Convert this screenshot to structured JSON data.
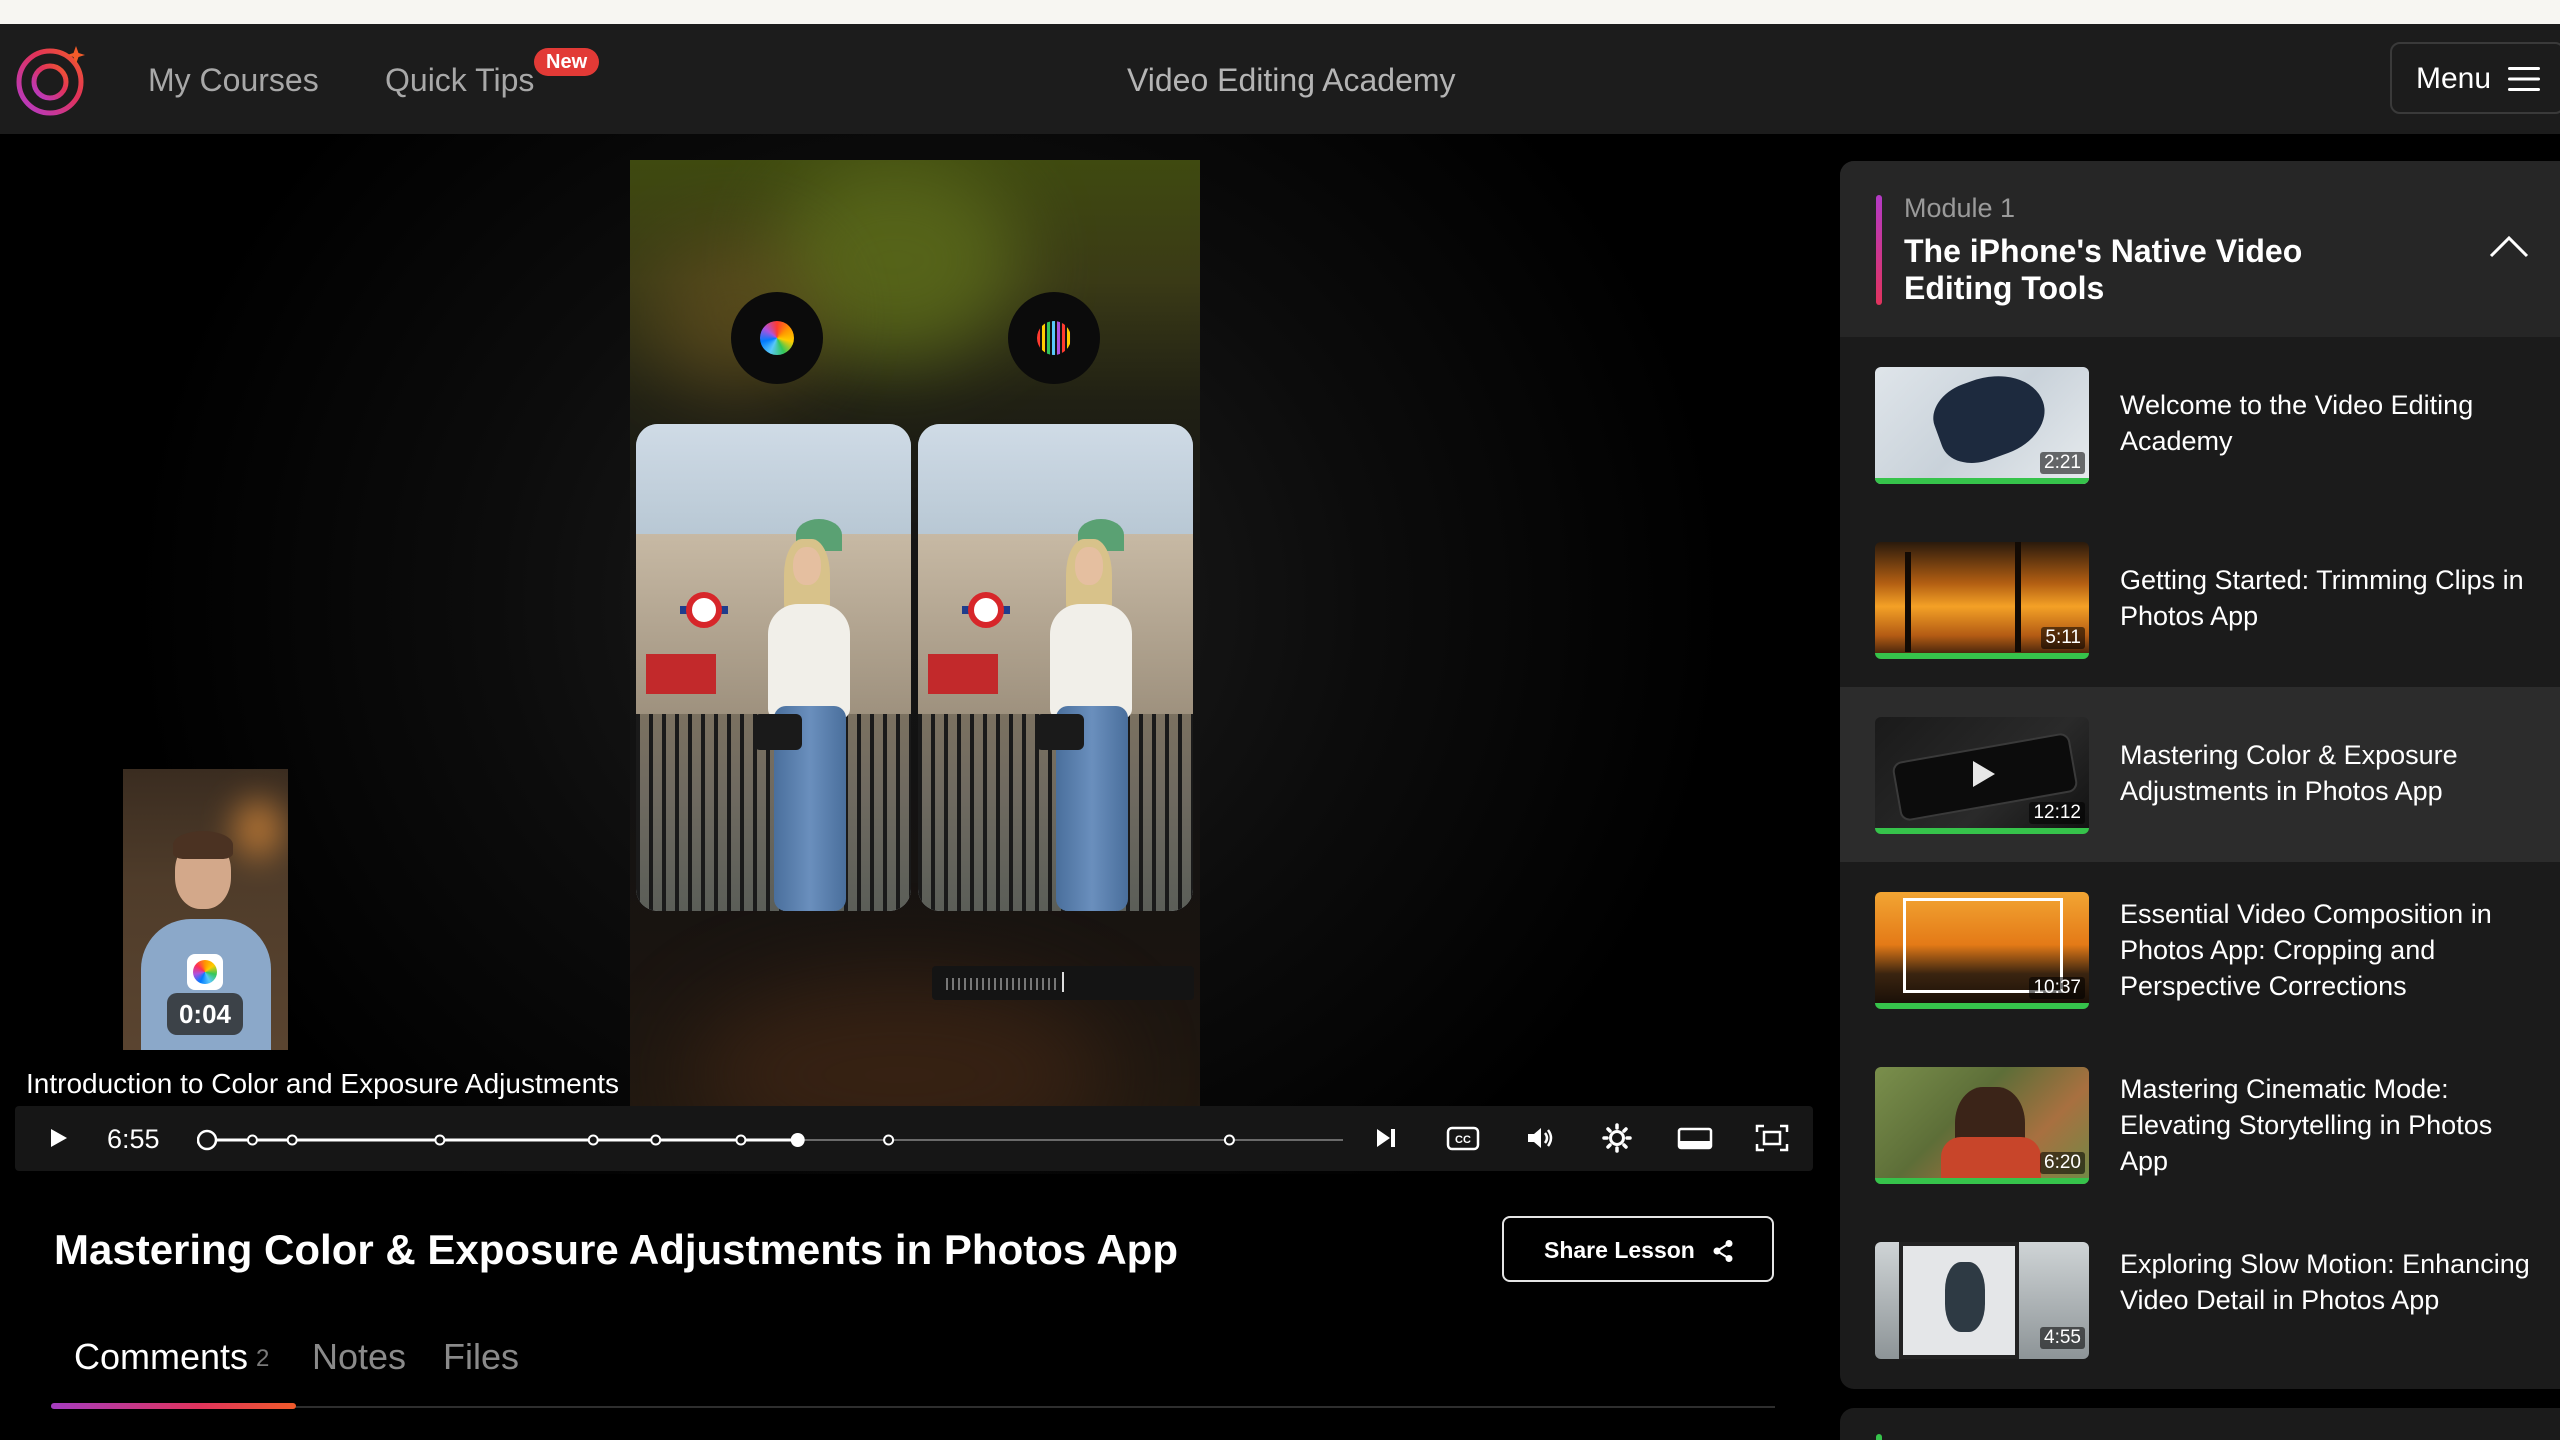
{
  "nav": {
    "my_courses": "My Courses",
    "quick_tips": "Quick Tips",
    "new_badge": "New",
    "site_title": "Video Editing Academy",
    "menu_label": "Menu"
  },
  "player": {
    "pip_time": "0:04",
    "subtitle": "Introduction to Color and Exposure Adjustments",
    "time_elapsed": "6:55",
    "progress_fraction": 0.52,
    "chapter_markers": [
      0.04,
      0.075,
      0.205,
      0.34,
      0.395,
      0.47,
      0.6,
      0.9
    ]
  },
  "lesson": {
    "title": "Mastering Color & Exposure Adjustments in Photos App",
    "share_label": "Share Lesson"
  },
  "tabs": {
    "comments": "Comments",
    "comments_count": "2",
    "notes": "Notes",
    "files": "Files"
  },
  "sidebar": {
    "module_label": "Module 1",
    "module_title": "The iPhone's Native Video Editing Tools",
    "lessons": [
      {
        "title": "Welcome to the Video Editing Academy",
        "duration": "2:21"
      },
      {
        "title": "Getting Started: Trimming Clips in Photos App",
        "duration": "5:11"
      },
      {
        "title": "Mastering Color & Exposure Adjustments in Photos App",
        "duration": "12:12",
        "active": true
      },
      {
        "title": "Essential Video Composition in Photos App: Cropping and Perspective Corrections",
        "duration": "10:37"
      },
      {
        "title": "Mastering Cinematic Mode: Elevating Storytelling in Photos App",
        "duration": "6:20"
      },
      {
        "title": "Exploring Slow Motion: Enhancing Video Detail in Photos App",
        "duration": "4:55"
      }
    ]
  },
  "colors": {
    "background": "#000000",
    "navbar": "#1c1c1c",
    "badge_red": "#e23a36",
    "progress_green": "#36c34b",
    "accent_gradient_start": "#a53cc0",
    "accent_gradient_end": "#e0335d"
  }
}
